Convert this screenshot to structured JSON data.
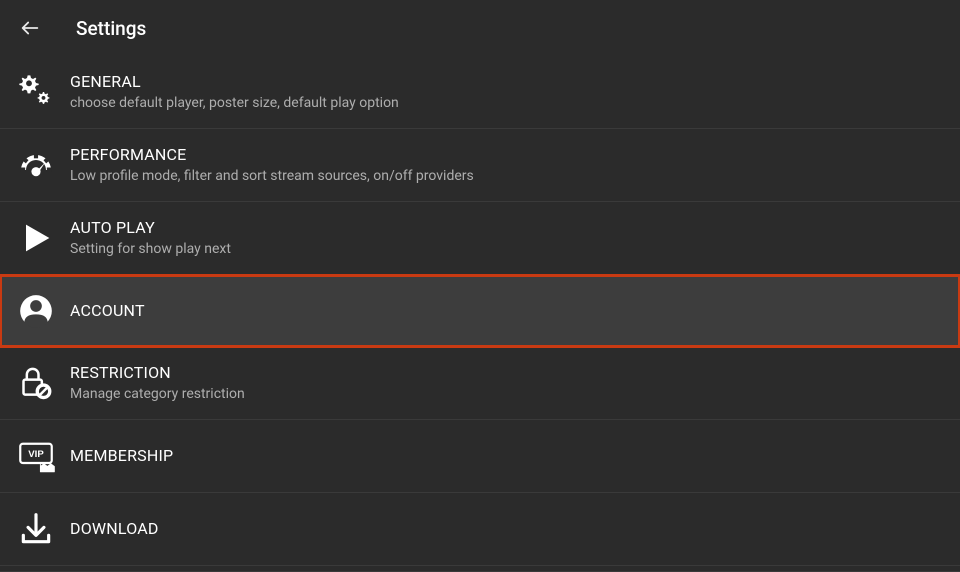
{
  "header": {
    "title": "Settings"
  },
  "items": [
    {
      "title": "GENERAL",
      "subtitle": "choose default player, poster size, default play option"
    },
    {
      "title": "PERFORMANCE",
      "subtitle": "Low profile mode, filter and sort stream sources, on/off providers"
    },
    {
      "title": "AUTO PLAY",
      "subtitle": "Setting for show play next"
    },
    {
      "title": "ACCOUNT",
      "subtitle": ""
    },
    {
      "title": "RESTRICTION",
      "subtitle": "Manage category restriction"
    },
    {
      "title": "MEMBERSHIP",
      "subtitle": ""
    },
    {
      "title": "DOWNLOAD",
      "subtitle": ""
    }
  ]
}
